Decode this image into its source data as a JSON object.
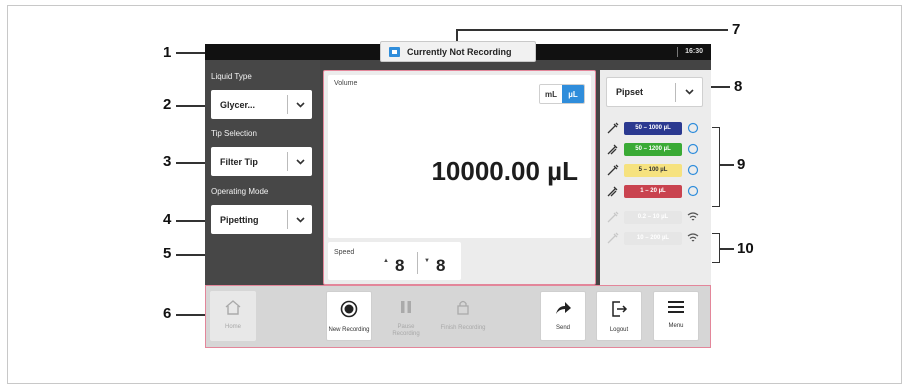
{
  "callouts": [
    "1",
    "2",
    "3",
    "4",
    "5",
    "6",
    "7",
    "8",
    "9",
    "10"
  ],
  "status_bar": {
    "time": "16:30"
  },
  "recording": {
    "status_text": "Currently Not Recording"
  },
  "left_panel": {
    "liquid_type_label": "Liquid Type",
    "liquid_type_value": "Glycer...",
    "tip_selection_label": "Tip Selection",
    "tip_selection_value": "Filter Tip",
    "operating_mode_label": "Operating Mode",
    "operating_mode_value": "Pipetting"
  },
  "volume": {
    "label": "Volume",
    "value": "10000.00 µL",
    "unit_ml": "mL",
    "unit_ul": "µL",
    "active_unit": "µL"
  },
  "speed": {
    "label": "Speed",
    "aspirate": "8",
    "dispense": "8"
  },
  "pipset": {
    "label": "Pipset"
  },
  "pipettes": [
    {
      "range": "50 – 1000 µL",
      "color": "#2b3990",
      "text_color": "#ffffff",
      "connection": "connected"
    },
    {
      "range": "50 – 1200 µL",
      "color": "#3aaa35",
      "text_color": "#ffffff",
      "connection": "connected"
    },
    {
      "range": "5 – 100 µL",
      "color": "#f6e27f",
      "text_color": "#333333",
      "connection": "connected"
    },
    {
      "range": "1 – 20 µL",
      "color": "#c9434f",
      "text_color": "#ffffff",
      "connection": "connected"
    },
    {
      "range": "0.2 – 10 µL",
      "color": "#e6e6e6",
      "text_color": "#ffffff",
      "connection": "wireless"
    },
    {
      "range": "10 – 200 µL",
      "color": "#e6e6e6",
      "text_color": "#ffffff",
      "connection": "wireless"
    }
  ],
  "toolbar": {
    "home": "Home",
    "new_recording": "New Recording",
    "pause_recording": "Pause Recording",
    "finish_recording": "Finish Recording",
    "send": "Send",
    "logout": "Logout",
    "menu": "Menu"
  },
  "colors": {
    "accent": "#2f8ddb",
    "callout_highlight": "#e3869a",
    "panel_dark": "#474747"
  }
}
